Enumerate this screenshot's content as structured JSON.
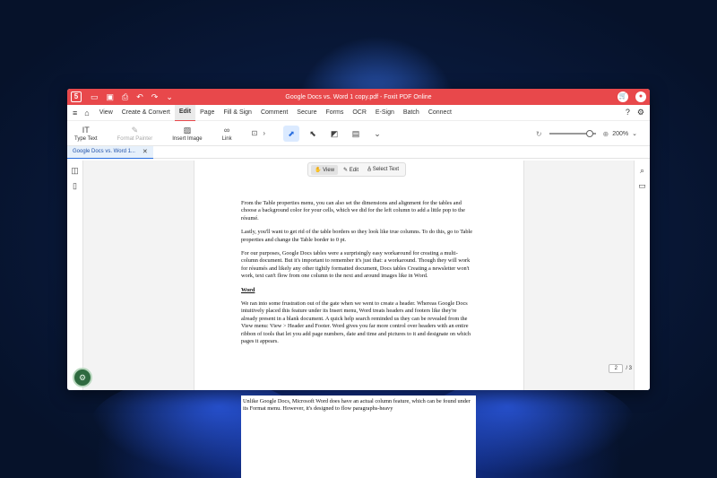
{
  "app": {
    "title": "Google Docs vs. Word 1 copy.pdf - Foxit PDF Online",
    "logo_letter": "5"
  },
  "titlebar": {
    "icons": [
      "folder-icon",
      "save-icon",
      "print-icon",
      "undo-icon",
      "redo-icon",
      "dropdown-icon"
    ],
    "right_icons": [
      "cart-icon",
      "user-icon"
    ]
  },
  "menu": {
    "items": [
      "View",
      "Create & Convert",
      "Edit",
      "Page",
      "Fill & Sign",
      "Comment",
      "Secure",
      "Forms",
      "OCR",
      "E-Sign",
      "Batch",
      "Connect"
    ],
    "active": "Edit"
  },
  "ribbon": {
    "type_text": "Type Text",
    "format_painter": "Format Painter",
    "insert_image": "Insert Image",
    "link": "Link",
    "zoom_level": "200%",
    "zoom_fraction": 0.88
  },
  "tab": {
    "label": "Google Docs vs. Word 1..."
  },
  "mode_toolbar": {
    "view": "View",
    "edit": "Edit",
    "select_text": "Select Text"
  },
  "document": {
    "paragraphs": [
      "From the Table properties menu, you can also set the dimensions and alignment for the tables and choose a background color for your cells, which we did for the left column to add a little pop to the résumé.",
      "Lastly, you'll want to get rid of the table borders so they look like true columns. To do this, go to Table properties and change the Table border to 0 pt.",
      "For our purposes, Google Docs tables were a surprisingly easy workaround for creating a multi-column document. But it's important to remember it's just that: a workaround. Though they will work for résumés and likely any other tightly formatted document, Docs tables Creating a newsletter won't work, text can't flow from one column to the next and around images like in Word."
    ],
    "heading": "Word",
    "paragraphs2": [
      "We ran into some frustration out of the gate when we went to create a header. Whereas Google Docs intuitively placed this feature under its Insert menu, Word treats headers and footers like they're already present in a blank document. A quick help search reminded us they can be revealed from the View menu: View > Header and Footer. Word gives you far more control over headers with an entire ribbon of tools that let you add page numbers, date and time and pictures to it and designate on which pages it appears."
    ],
    "overflow": "Unlike Google Docs, Microsoft Word does have an actual column feature, which can be found under its Format menu. However, it's designed to flow paragraphs-heavy"
  },
  "page_nav": {
    "current": "2",
    "total": "/ 3"
  },
  "badge": {
    "text": "⚙"
  }
}
